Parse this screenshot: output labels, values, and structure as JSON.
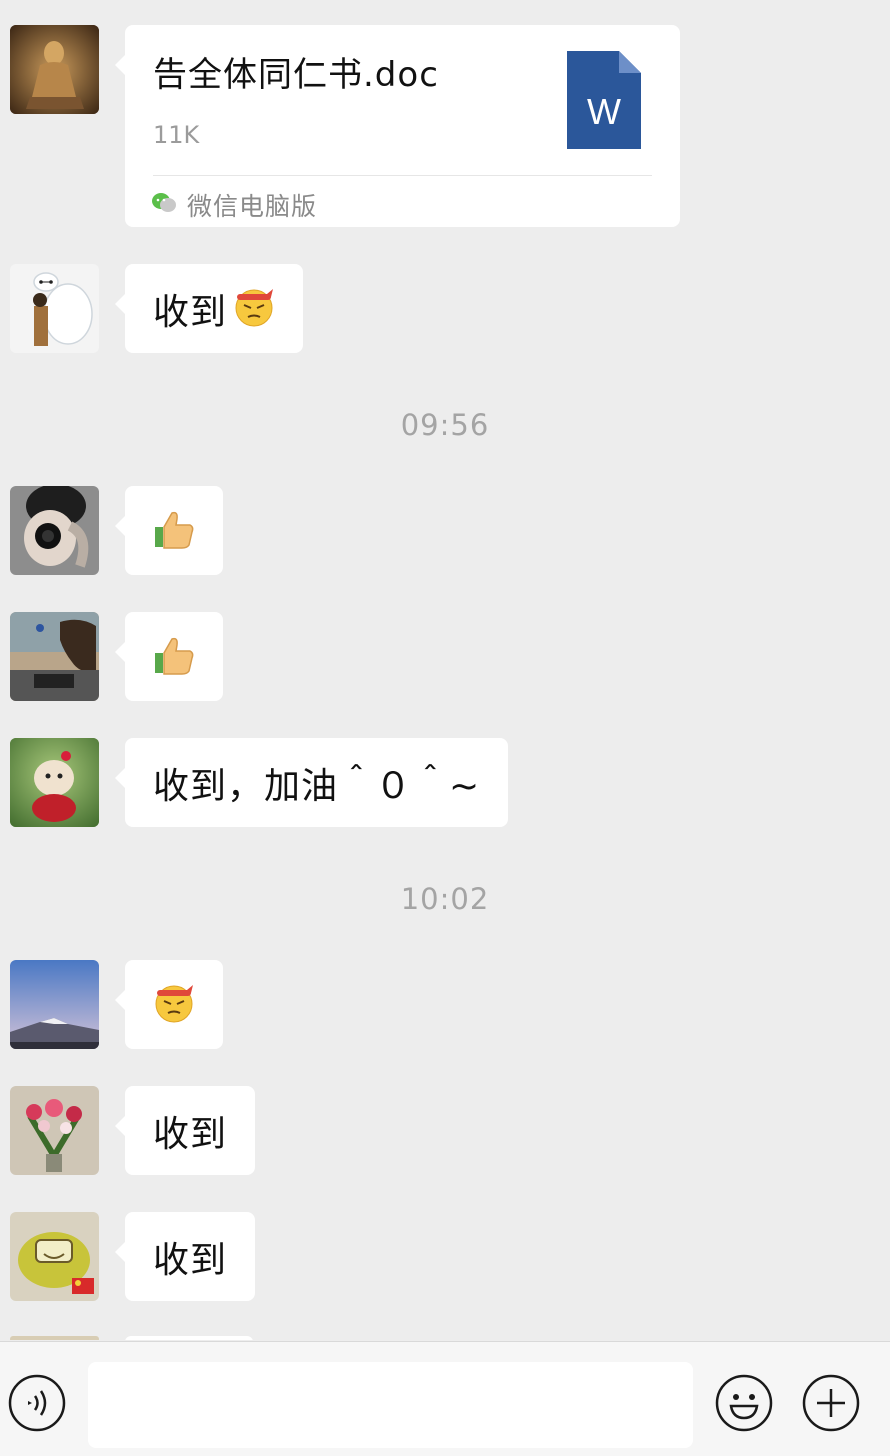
{
  "messages": {
    "file": {
      "file_name": "告全体同仁书.doc",
      "file_size": "11K",
      "file_type_letter": "W",
      "source_label": "微信电脑版"
    },
    "msg_baymax": {
      "text": "收到"
    },
    "timestamp_1": "09:56",
    "msg_camera": {
      "emoji": "thumbs-up"
    },
    "msg_horse": {
      "emoji": "thumbs-up"
    },
    "msg_dog": {
      "text": "收到，加油＾０＾~"
    },
    "timestamp_2": "10:02",
    "msg_mountain": {
      "emoji": "frustrated-face"
    },
    "msg_flowers": {
      "text": "收到"
    },
    "msg_car": {
      "text": "收到"
    }
  },
  "input_bar": {
    "voice_icon": "voice-icon",
    "emoji_icon": "emoji-icon",
    "plus_icon": "plus-icon",
    "input_value": ""
  },
  "colors": {
    "background": "#ededed",
    "bubble": "#ffffff",
    "word_blue": "#2b579a",
    "timestamp": "#a4a4a4"
  }
}
